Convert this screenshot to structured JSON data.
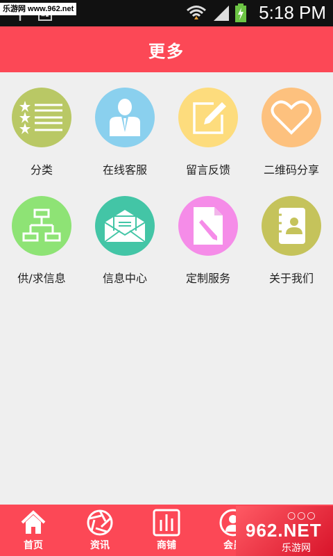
{
  "status_bar": {
    "watermark": "乐游网 www.962.net",
    "time": "5:18 PM"
  },
  "header": {
    "title": "更多"
  },
  "grid": [
    {
      "label": "分类",
      "icon": "starred-list-icon",
      "color": "#b9c865"
    },
    {
      "label": "在线客服",
      "icon": "customer-service-person-icon",
      "color": "#8ad0ee"
    },
    {
      "label": "留言反馈",
      "icon": "note-pencil-icon",
      "color": "#fddc7d"
    },
    {
      "label": "二维码分享",
      "icon": "heart-icon",
      "color": "#fdc17e"
    },
    {
      "label": "供/求信息",
      "icon": "org-chart-icon",
      "color": "#8ee375"
    },
    {
      "label": "信息中心",
      "icon": "envelope-icon",
      "color": "#43c5a6"
    },
    {
      "label": "定制服务",
      "icon": "document-pencil-icon",
      "color": "#f58ce8"
    },
    {
      "label": "关于我们",
      "icon": "contact-book-icon",
      "color": "#c5c35b"
    }
  ],
  "bottom_nav": [
    {
      "label": "首页",
      "icon": "home-icon"
    },
    {
      "label": "资讯",
      "icon": "aperture-icon"
    },
    {
      "label": "商铺",
      "icon": "bar-chart-icon"
    },
    {
      "label": "会员",
      "icon": "member-icon"
    }
  ],
  "watermark_bottom": {
    "brand": "962.NET",
    "site": "乐游网"
  },
  "colors": {
    "accent": "#fc4856",
    "background": "#efefef"
  }
}
